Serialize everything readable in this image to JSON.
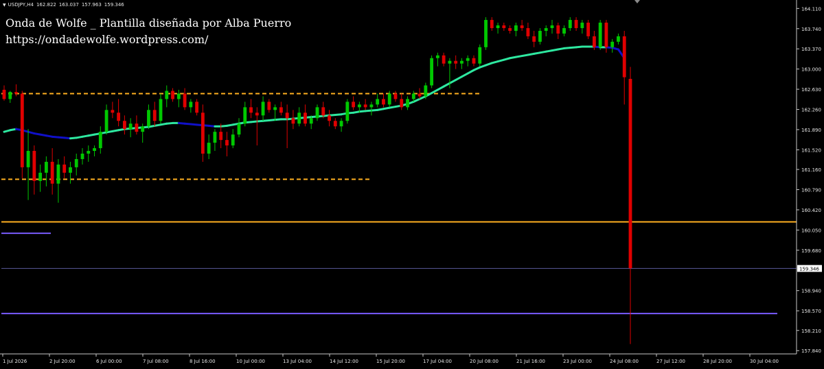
{
  "symbol_bar": {
    "symbol": "USDJPY,H4",
    "open": "162.822",
    "high": "163.037",
    "low": "157.963",
    "close": "159.346"
  },
  "overlay": {
    "title": "Onda de Wolfe _ Plantilla diseñada por Alba Puerro",
    "url": "https://ondadewolfe.wordpress.com/"
  },
  "colors": {
    "background": "#000000",
    "bull": "#00c800",
    "bear": "#e00000",
    "ma_rising": "#2ee8a0",
    "ma_falling": "#1010c8",
    "level_orange": "#ffb020",
    "level_purple": "#7a5cff",
    "current_price_line": "#5a5a9a",
    "axis": "#c8c8c8"
  },
  "price_axis": {
    "ticks": [
      "164.110",
      "163.740",
      "163.370",
      "163.000",
      "162.630",
      "162.260",
      "161.890",
      "161.520",
      "161.160",
      "160.790",
      "160.420",
      "160.050",
      "159.680",
      "158.940",
      "158.570",
      "158.210",
      "157.840"
    ],
    "current_price": "159.346",
    "range": [
      157.78,
      164.24
    ]
  },
  "time_axis": {
    "ticks": [
      "1 Jul 2026",
      "2 Jul 20:00",
      "6 Jul 00:00",
      "7 Jul 08:00",
      "8 Jul 16:00",
      "10 Jul 00:00",
      "13 Jul 04:00",
      "14 Jul 12:00",
      "15 Jul 20:00",
      "17 Jul 04:00",
      "20 Jul 08:00",
      "21 Jul 16:00",
      "23 Jul 00:00",
      "24 Jul 08:00",
      "27 Jul 12:00",
      "28 Jul 20:00",
      "30 Jul 04:00"
    ]
  },
  "chart_data": {
    "type": "candlestick",
    "symbol": "USDJPY",
    "timeframe": "H4",
    "x": [
      "1 Jul 2026",
      "2 Jul 20:00",
      "6 Jul 00:00",
      "7 Jul 08:00",
      "8 Jul 16:00",
      "10 Jul 00:00",
      "13 Jul 04:00",
      "14 Jul 12:00",
      "15 Jul 20:00",
      "17 Jul 04:00",
      "20 Jul 08:00",
      "21 Jul 16:00",
      "23 Jul 00:00",
      "24 Jul 08:00",
      "27 Jul 12:00",
      "28 Jul 20:00",
      "30 Jul 04:00"
    ],
    "candles_ohlc": [
      [
        162.62,
        162.7,
        162.42,
        162.45
      ],
      [
        162.45,
        162.6,
        162.38,
        162.58
      ],
      [
        162.58,
        162.72,
        162.5,
        162.55
      ],
      [
        162.55,
        162.6,
        161.0,
        161.2
      ],
      [
        161.2,
        161.9,
        160.6,
        161.5
      ],
      [
        161.5,
        161.6,
        160.7,
        160.95
      ],
      [
        160.95,
        161.25,
        160.75,
        161.1
      ],
      [
        161.1,
        161.4,
        160.85,
        161.3
      ],
      [
        161.3,
        161.55,
        160.7,
        160.9
      ],
      [
        160.9,
        161.35,
        160.55,
        161.25
      ],
      [
        161.25,
        161.4,
        161.0,
        161.1
      ],
      [
        161.1,
        161.3,
        160.9,
        161.2
      ],
      [
        161.2,
        161.45,
        161.05,
        161.35
      ],
      [
        161.35,
        161.55,
        161.25,
        161.45
      ],
      [
        161.45,
        161.6,
        161.3,
        161.5
      ],
      [
        161.5,
        161.6,
        161.4,
        161.55
      ],
      [
        161.55,
        161.95,
        161.45,
        161.85
      ],
      [
        161.85,
        162.35,
        161.8,
        162.25
      ],
      [
        162.25,
        162.4,
        162.1,
        162.2
      ],
      [
        162.2,
        162.45,
        161.95,
        162.05
      ],
      [
        162.05,
        162.15,
        161.8,
        161.9
      ],
      [
        161.9,
        162.1,
        161.75,
        162.0
      ],
      [
        162.0,
        162.15,
        161.8,
        161.85
      ],
      [
        161.85,
        162.0,
        161.65,
        161.95
      ],
      [
        161.95,
        162.35,
        161.9,
        162.25
      ],
      [
        162.25,
        162.4,
        161.95,
        162.05
      ],
      [
        162.05,
        162.55,
        162.0,
        162.45
      ],
      [
        162.45,
        162.7,
        162.3,
        162.6
      ],
      [
        162.6,
        162.65,
        162.4,
        162.45
      ],
      [
        162.45,
        162.62,
        162.3,
        162.55
      ],
      [
        162.55,
        162.65,
        162.25,
        162.3
      ],
      [
        162.3,
        162.45,
        162.2,
        162.4
      ],
      [
        162.4,
        162.45,
        162.15,
        162.2
      ],
      [
        162.2,
        162.35,
        161.3,
        161.45
      ],
      [
        161.45,
        161.8,
        161.35,
        161.65
      ],
      [
        161.65,
        161.9,
        161.5,
        161.85
      ],
      [
        161.85,
        162.0,
        161.55,
        161.7
      ],
      [
        161.7,
        161.85,
        161.4,
        161.6
      ],
      [
        161.6,
        161.9,
        161.55,
        161.8
      ],
      [
        161.8,
        162.1,
        161.75,
        162.0
      ],
      [
        162.0,
        162.4,
        161.95,
        162.3
      ],
      [
        162.3,
        162.45,
        162.1,
        162.2
      ],
      [
        162.2,
        162.3,
        161.6,
        162.15
      ],
      [
        162.15,
        162.5,
        162.05,
        162.4
      ],
      [
        162.4,
        162.45,
        162.2,
        162.25
      ],
      [
        162.25,
        162.35,
        162.05,
        162.3
      ],
      [
        162.3,
        162.4,
        162.15,
        162.2
      ],
      [
        162.2,
        162.35,
        161.55,
        162.1
      ],
      [
        162.1,
        162.25,
        161.9,
        162.0
      ],
      [
        162.0,
        162.3,
        161.95,
        162.2
      ],
      [
        162.2,
        162.35,
        161.95,
        162.0
      ],
      [
        162.0,
        162.15,
        161.9,
        162.1
      ],
      [
        162.1,
        162.35,
        162.05,
        162.3
      ],
      [
        162.3,
        162.4,
        162.1,
        162.15
      ],
      [
        162.15,
        162.25,
        161.95,
        162.05
      ],
      [
        162.05,
        162.1,
        161.9,
        161.95
      ],
      [
        161.95,
        162.1,
        161.85,
        162.05
      ],
      [
        162.05,
        162.45,
        162.0,
        162.4
      ],
      [
        162.4,
        162.5,
        162.25,
        162.3
      ],
      [
        162.3,
        162.4,
        162.2,
        162.35
      ],
      [
        162.35,
        162.45,
        162.25,
        162.3
      ],
      [
        162.3,
        162.4,
        162.15,
        162.35
      ],
      [
        162.35,
        162.55,
        162.3,
        162.45
      ],
      [
        162.45,
        162.55,
        162.3,
        162.35
      ],
      [
        162.35,
        162.6,
        162.3,
        162.55
      ],
      [
        162.55,
        162.6,
        162.4,
        162.45
      ],
      [
        162.45,
        162.55,
        162.25,
        162.3
      ],
      [
        162.3,
        162.5,
        162.25,
        162.45
      ],
      [
        162.45,
        162.6,
        162.4,
        162.55
      ],
      [
        162.55,
        162.65,
        162.45,
        162.5
      ],
      [
        162.5,
        162.75,
        162.45,
        162.7
      ],
      [
        162.7,
        163.25,
        162.65,
        163.2
      ],
      [
        163.2,
        163.3,
        163.05,
        163.25
      ],
      [
        163.25,
        163.3,
        163.05,
        163.1
      ],
      [
        163.1,
        163.2,
        162.65,
        163.15
      ],
      [
        163.15,
        163.25,
        163.0,
        163.1
      ],
      [
        163.1,
        163.2,
        163.0,
        163.15
      ],
      [
        163.15,
        163.25,
        163.05,
        163.2
      ],
      [
        163.2,
        163.25,
        163.05,
        163.1
      ],
      [
        163.1,
        163.45,
        163.05,
        163.4
      ],
      [
        163.4,
        163.95,
        163.35,
        163.9
      ],
      [
        163.9,
        163.95,
        163.7,
        163.75
      ],
      [
        163.75,
        163.85,
        163.65,
        163.8
      ],
      [
        163.8,
        163.85,
        163.7,
        163.75
      ],
      [
        163.75,
        163.8,
        163.65,
        163.7
      ],
      [
        163.7,
        163.85,
        163.6,
        163.8
      ],
      [
        163.8,
        163.9,
        163.7,
        163.75
      ],
      [
        163.75,
        163.85,
        163.55,
        163.6
      ],
      [
        163.6,
        163.7,
        163.4,
        163.5
      ],
      [
        163.5,
        163.75,
        163.45,
        163.7
      ],
      [
        163.7,
        163.8,
        163.6,
        163.75
      ],
      [
        163.75,
        163.9,
        163.65,
        163.8
      ],
      [
        163.8,
        163.85,
        163.55,
        163.65
      ],
      [
        163.65,
        163.8,
        163.6,
        163.75
      ],
      [
        163.75,
        163.95,
        163.7,
        163.9
      ],
      [
        163.9,
        163.95,
        163.7,
        163.75
      ],
      [
        163.75,
        163.9,
        163.65,
        163.85
      ],
      [
        163.85,
        163.9,
        163.55,
        163.6
      ],
      [
        163.6,
        163.7,
        163.35,
        163.4
      ],
      [
        163.4,
        163.9,
        163.35,
        163.85
      ],
      [
        163.85,
        163.9,
        163.3,
        163.4
      ],
      [
        163.4,
        163.55,
        163.3,
        163.5
      ],
      [
        163.5,
        163.65,
        163.45,
        163.6
      ],
      [
        163.6,
        163.7,
        162.35,
        162.85
      ],
      [
        162.82,
        163.04,
        157.96,
        159.35
      ]
    ],
    "moving_average": {
      "from_index": 0,
      "values": [
        161.85,
        161.88,
        161.9,
        161.88,
        161.85,
        161.82,
        161.8,
        161.78,
        161.76,
        161.75,
        161.74,
        161.73,
        161.74,
        161.76,
        161.78,
        161.8,
        161.82,
        161.84,
        161.86,
        161.88,
        161.9,
        161.91,
        161.92,
        161.93,
        161.94,
        161.96,
        161.98,
        162.0,
        162.01,
        162.01,
        162.0,
        161.99,
        161.98,
        161.97,
        161.96,
        161.95,
        161.95,
        161.96,
        161.98,
        162.0,
        162.02,
        162.03,
        162.04,
        162.05,
        162.06,
        162.07,
        162.08,
        162.08,
        162.09,
        162.1,
        162.11,
        162.12,
        162.13,
        162.14,
        162.15,
        162.16,
        162.17,
        162.19,
        162.2,
        162.22,
        162.23,
        162.24,
        162.25,
        162.27,
        162.29,
        162.31,
        162.33,
        162.36,
        162.4,
        162.45,
        162.5,
        162.56,
        162.62,
        162.68,
        162.74,
        162.8,
        162.86,
        162.92,
        162.98,
        163.03,
        163.07,
        163.11,
        163.14,
        163.17,
        163.2,
        163.22,
        163.24,
        163.26,
        163.28,
        163.3,
        163.32,
        163.34,
        163.36,
        163.38,
        163.39,
        163.4,
        163.41,
        163.41,
        163.41,
        163.4,
        163.4,
        163.39,
        163.36,
        163.2
      ]
    },
    "levels": [
      {
        "price": 162.55,
        "style": "dashed",
        "color": "#ffb020"
      },
      {
        "price": 160.98,
        "style": "dashed",
        "color": "#ffb020"
      },
      {
        "price": 160.2,
        "style": "solid",
        "color": "#ffb020"
      },
      {
        "price": 159.99,
        "style": "solid",
        "color": "#7a5cff"
      },
      {
        "price": 159.346,
        "style": "solid",
        "color": "#5a5a9a"
      },
      {
        "price": 158.52,
        "style": "solid",
        "color": "#7a5cff"
      }
    ],
    "ylim": [
      157.78,
      164.24
    ],
    "grid": false
  }
}
